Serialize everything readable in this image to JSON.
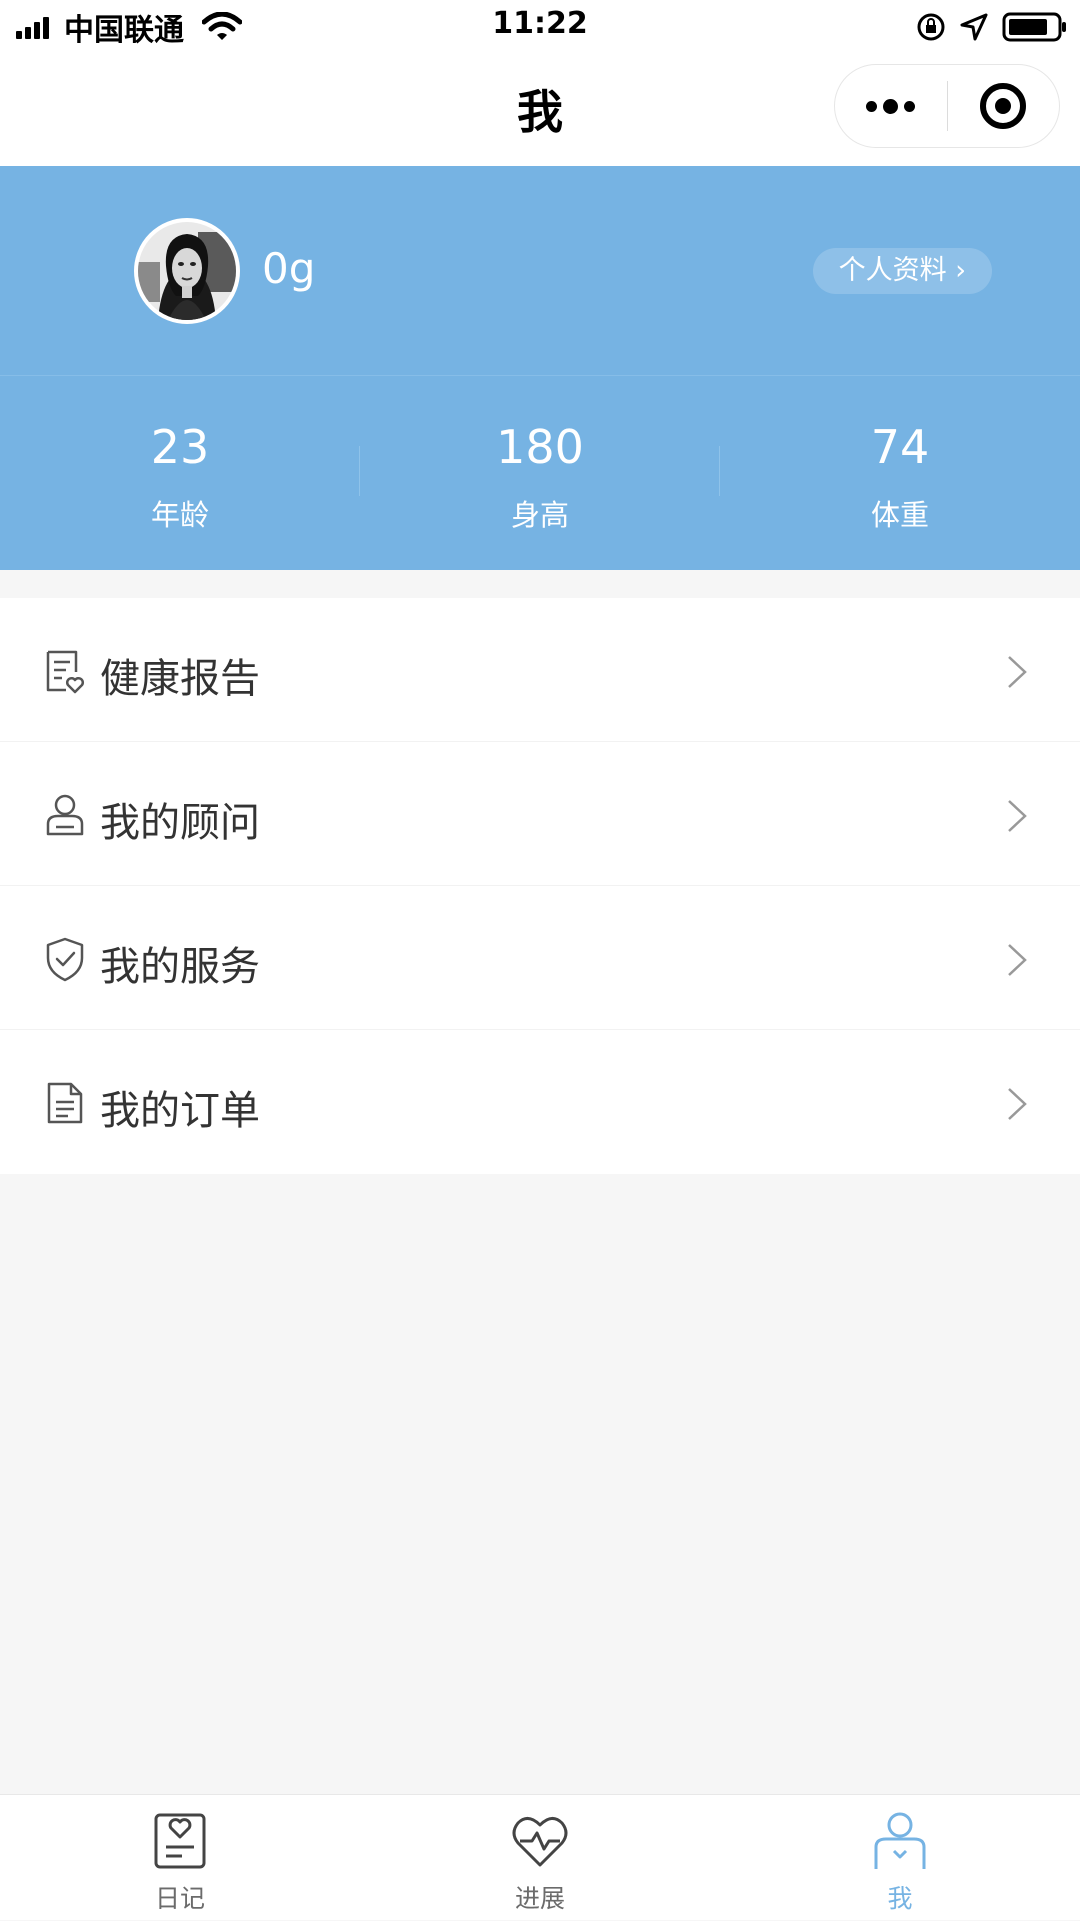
{
  "status_bar": {
    "carrier": "中国联通",
    "time": "11:22",
    "icons": [
      "signal-icon",
      "wifi-icon",
      "orientation-lock-icon",
      "location-icon",
      "battery-icon"
    ]
  },
  "nav": {
    "title": "我",
    "capsule_icons": [
      "more-icon",
      "close-target-icon"
    ]
  },
  "profile": {
    "username": "0g",
    "profile_link": "个人资料 ›",
    "background_color": "#76b3e3",
    "stats": [
      {
        "value": "23",
        "label": "年龄"
      },
      {
        "value": "180",
        "label": "身高"
      },
      {
        "value": "74",
        "label": "体重"
      }
    ]
  },
  "menu": {
    "items": [
      {
        "label": "健康报告",
        "icon": "health-report-icon"
      },
      {
        "label": "我的顾问",
        "icon": "consultant-icon"
      },
      {
        "label": "我的服务",
        "icon": "shield-check-icon"
      },
      {
        "label": "我的订单",
        "icon": "order-document-icon"
      }
    ]
  },
  "tab_bar": {
    "active_color": "#76b3e3",
    "tabs": [
      {
        "label": "日记",
        "icon": "diary-icon",
        "active": false
      },
      {
        "label": "进展",
        "icon": "heart-pulse-icon",
        "active": false
      },
      {
        "label": "我",
        "icon": "person-icon",
        "active": true
      }
    ]
  }
}
